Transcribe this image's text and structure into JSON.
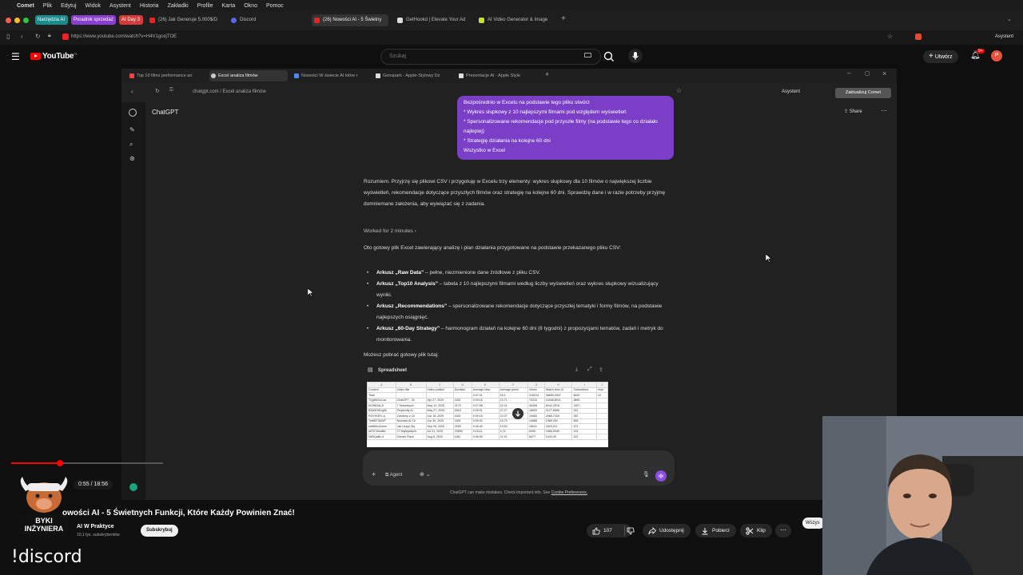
{
  "menubar": {
    "app": "Comet",
    "items": [
      "Plik",
      "Edytuj",
      "Widok",
      "Asystent",
      "Historia",
      "Zakładki",
      "Profile",
      "Karta",
      "Okno",
      "Pomoc"
    ]
  },
  "outer_tabs": {
    "tags": [
      {
        "label": "Narzędzia AI",
        "color": "#1a8c8c"
      },
      {
        "label": "Poradnik sprzedaż",
        "color": "#8a3fd1"
      },
      {
        "label": "AI Day 3",
        "color": "#d63a3a"
      }
    ],
    "tabs": [
      {
        "label": "(26) Jak Generuje 5.000$/D",
        "fav": "#e22"
      },
      {
        "label": "Discord",
        "fav": "#5865f2"
      },
      {
        "label": "(26) Nowości AI - 5 Świetny",
        "fav": "#e22",
        "active": true
      },
      {
        "label": "GetHookd | Elevate Your Ad",
        "fav": "#ddd"
      },
      {
        "label": "AI Video Generator & Image",
        "fav": "#c8e033"
      }
    ],
    "new_tab": "+"
  },
  "address": {
    "url": "https://www.youtube.com/watch?v=H4V1gcejTOE",
    "assistant": "Asystent"
  },
  "youtube": {
    "logo_text": "YouTube",
    "logo_sup": "PL",
    "search_placeholder": "Szukaj",
    "create_label": "Utwórz",
    "notif_count": "9+",
    "avatar_letter": "P"
  },
  "inner_browser": {
    "tabs": [
      {
        "label": "Top 10 films performance an"
      },
      {
        "label": "Excel analiza filmów",
        "active": true
      },
      {
        "label": "Nowości W świecie AI które r"
      },
      {
        "label": "Genspark - Apple-Stylowy Dz"
      },
      {
        "label": "Prezentacje AI - Apple Style"
      }
    ],
    "url": "chatgpt.com / Excel analiza filmów",
    "assistant": "Asystent",
    "update_label": "Zaktualizuj Comet"
  },
  "chatgpt": {
    "title": "ChatGPT",
    "share": "Share",
    "user_message": [
      "Bezpośrednio w Excelu na podstawie tego pliku stwórz",
      "* Wykres słupkowy z 10 najlepszymi filmami pod względem wyświetleń",
      "* Spersonalizowane rekomendacje pod przyszłe filmy (na podstawie tego co działało najlepiej)",
      "* Strategię działania na kolejne 60 dni",
      "Wszystko w Excel"
    ],
    "intro": "Rozumiem. Przyjrzę się plikowi CSV i przygotuję w Excelu trzy elementy: wykres słupkowy dla 10 filmów o największej liczbie wyświetleń, rekomendacje dotyczące przyszłych filmów oraz strategię na kolejne 60 dni. Sprawdzę dane i w razie potrzeby przyjmę domniemane założenia, aby wywiązać się z zadania.",
    "worked": "Worked for 2 minutes",
    "ready": "Oto gotowy plik Excel zawierający analizę i plan działania przygotowane na podstawie przekazanego pliku CSV:",
    "bullets": [
      {
        "bold": "Arkusz „Raw Data”",
        "text": " – pełne, niezmienione dane źródłowe z pliku CSV."
      },
      {
        "bold": "Arkusz „Top10 Analysis”",
        "text": " – tabela z 10 najlepszymi filmami według liczby wyświetleń oraz wykres słupkowy wizualizujący wyniki."
      },
      {
        "bold": "Arkusz „Recommendations”",
        "text": " – spersonalizowane rekomendacje dotyczące przyszłej tematyki i formy filmów, na podstawie najlepszych osiągnięć."
      },
      {
        "bold": "Arkusz „60-Day Strategy”",
        "text": " – harmonogram działań na kolejne 60 dni (8 tygodni) z propozycjami tematów, zadań i metryk do monitorowania."
      }
    ],
    "download": "Możesz pobrać gotowy plik tutaj:",
    "sheet_label": "Spreadsheet",
    "sheet": {
      "cols": [
        "A",
        "B",
        "C",
        "D",
        "E",
        "F",
        "G",
        "H",
        "I",
        "J"
      ],
      "header": [
        "Content",
        "Video title",
        "Video publish",
        "Duration",
        "Average view",
        "Average perce",
        "Views",
        "Watch time (h",
        "Subscribers",
        "Impr"
      ],
      "rows": [
        [
          "Total",
          "",
          "",
          "",
          "0:07:31",
          "18,1",
          "318224",
          "38683,0907",
          "4632",
          "10"
        ],
        [
          "TQg9hGcLow",
          "ChatGPT - 30",
          "Apr 27, 2025",
          "1601",
          "0:09:16",
          "15,71",
          "75233",
          "11638,8514",
          "3889",
          ""
        ],
        [
          "KD3fb3AL2I",
          "7 Sekretnych",
          "May 12, 2025",
          "2179",
          "0:07:58",
          "22,01",
          "45458",
          "6042,2678",
          "1307",
          ""
        ],
        [
          "BZk0E9Kxg0k",
          "Perplexity AI",
          "May 27, 2025",
          "2818",
          "0:09:31",
          "27,27",
          "18893",
          "2127,5896",
          "331",
          ""
        ],
        [
          "RGYHGFo-U",
          "Zarobmy z Ch",
          "Jun 18, 2025",
          "1601",
          "0:09:15",
          "22,07",
          "19483",
          "2966,7328",
          "282",
          ""
        ],
        [
          "Tw6i5TGkWF",
          "Nowości AI Ch",
          "Jun 30, 2025",
          "1601",
          "0:09:02",
          "18,79",
          "14668",
          "1965,254",
          "606",
          ""
        ],
        [
          "kdd8UIuAnnm",
          "Jak Uczyć Się",
          "Sep 26, 2025",
          "2055",
          "0:06:40",
          "19,53",
          "18041",
          "1823,211",
          "473",
          ""
        ],
        [
          "p8ThTwnoBA",
          "27 Najlepszych",
          "Jul 31, 2025",
          "20859",
          "0:16:11",
          "4,74",
          "5490",
          "1666,5945",
          "103",
          ""
        ],
        [
          "NWIQaBv-4",
          "Gemini Flash",
          "Aug 8, 2025",
          "1811",
          "0:06:55",
          "21,91",
          "8477",
          "1043,09",
          "222",
          ""
        ]
      ]
    },
    "agent_label": "Agent",
    "disclaimer_pre": "ChatGPT can make mistakes. Check important info. See",
    "disclaimer_link": "Cookie Preferences."
  },
  "player": {
    "time": "0:55 / 18:56",
    "progress": 0.049,
    "video_title": "owości AI - 5 Świetnych Funkcji, Które Każdy Powinien Znać!",
    "channel_name": "AI W Praktyce",
    "channel_logo_text": "BYKI INŻYNIERA",
    "subs": "10,1 tys. subskrybentów",
    "subscribe": "Subskrybuj",
    "likes": "107",
    "share": "Udostępnij",
    "download": "Pobierz",
    "clip": "Klip",
    "side_btn": "Wszys"
  },
  "overlay": {
    "discord_cmd": "!discord"
  }
}
